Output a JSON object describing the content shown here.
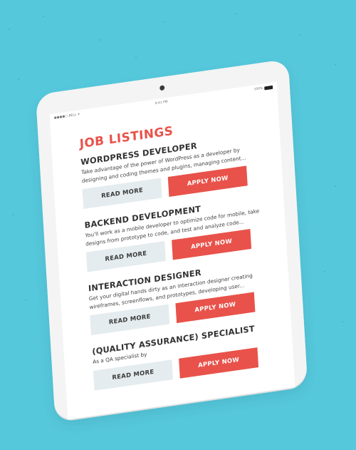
{
  "status_bar": {
    "carrier": "●●●●○ BELL ✈",
    "time": "9:41 PM",
    "battery": "100%"
  },
  "page": {
    "title": "JOB LISTINGS"
  },
  "jobs": [
    {
      "title": "WORDPRESS DEVELOPER",
      "desc_line1": "Take advantage of the power of WordPress as a developer by",
      "desc_line2": "designing and coding themes and plugins, managing content...",
      "read_more": "READ MORE",
      "apply": "APPLY NOW"
    },
    {
      "title": "BACKEND DEVELOPMENT",
      "desc_line1": "You'll work as a mobile developer to optimize code for mobile, take",
      "desc_line2": "designs from prototype to code, and test and analyze code...",
      "read_more": "READ MORE",
      "apply": "APPLY NOW"
    },
    {
      "title": "INTERACTION DESIGNER",
      "desc_line1": "Get your digital hands dirty as an interaction designer creating",
      "desc_line2": "wireframes, screenflows, and prototypes, developing user...",
      "read_more": "READ MORE",
      "apply": "APPLY NOW"
    },
    {
      "title": "(QUALITY ASSURANCE) SPECIALIST",
      "desc_line1": "As a QA specialist by",
      "desc_line2": "",
      "read_more": "READ MORE",
      "apply": "APPLY NOW"
    }
  ],
  "colors": {
    "background": "#56c8dc",
    "accent": "#e8524a",
    "secondary_button": "#e5ecef"
  }
}
